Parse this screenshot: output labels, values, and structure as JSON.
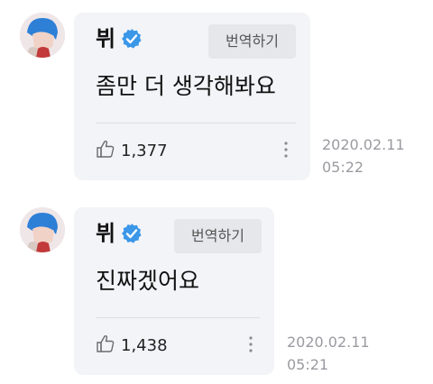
{
  "messages": [
    {
      "author": "뷔",
      "verified_icon": "verified-check-icon",
      "translate_label": "번역하기",
      "text": "좀만 더 생각해봐요",
      "likes": "1,377",
      "date": "2020.02.11",
      "time": "05:22"
    },
    {
      "author": "뷔",
      "verified_icon": "verified-check-icon",
      "translate_label": "번역하기",
      "text": "진짜겠어요",
      "likes": "1,438",
      "date": "2020.02.11",
      "time": "05:21"
    }
  ],
  "colors": {
    "verified": "#3b97e8",
    "bubble": "#f3f4f8",
    "timestamp": "#9a9ba0"
  }
}
